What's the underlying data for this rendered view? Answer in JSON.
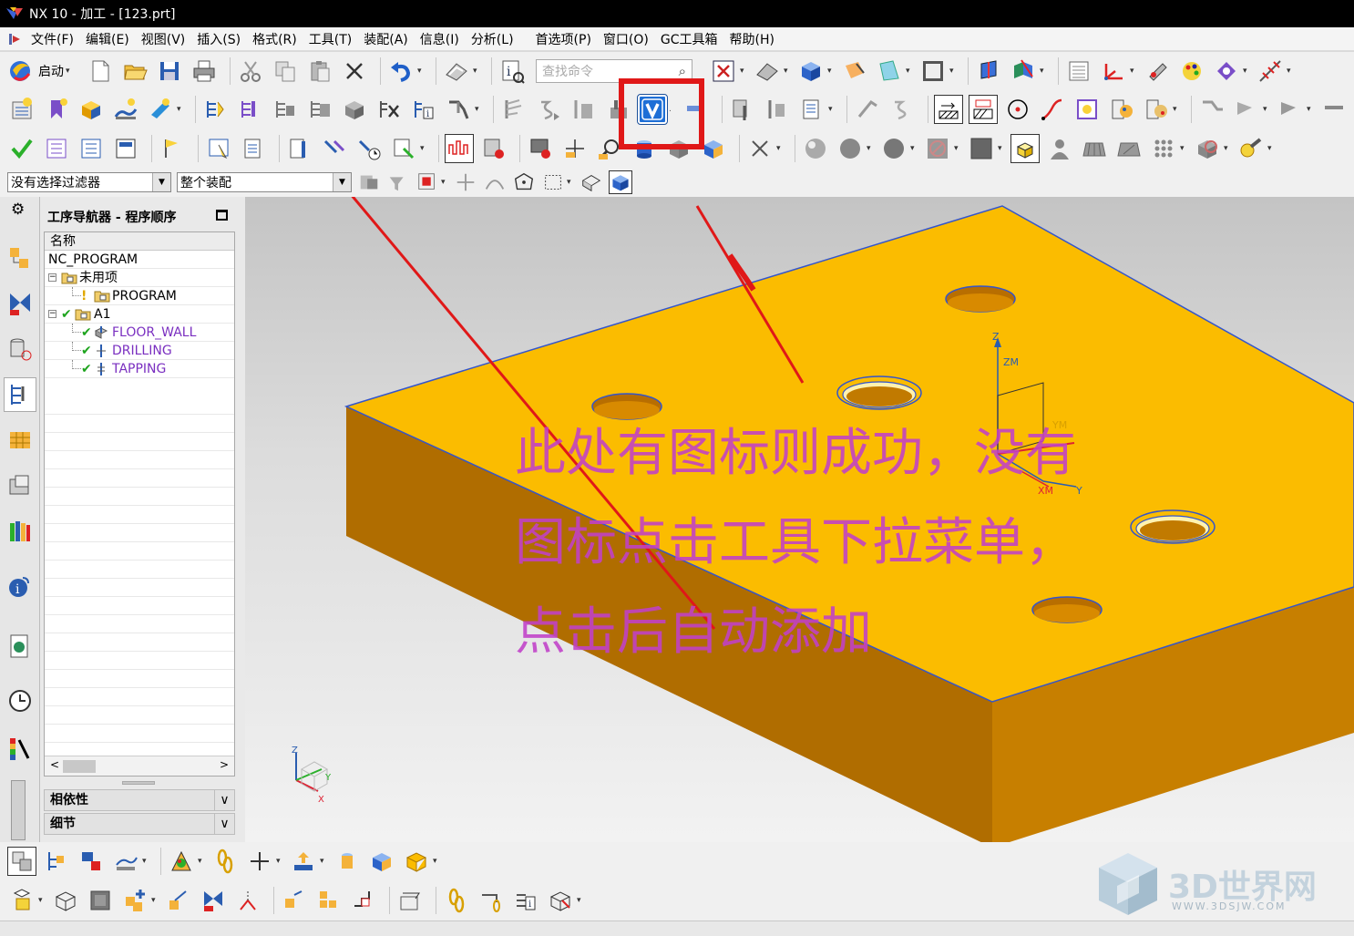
{
  "window": {
    "title": "NX 10 - 加工 - [123.prt]"
  },
  "menu": {
    "items": [
      {
        "label": "文件(F)"
      },
      {
        "label": "编辑(E)"
      },
      {
        "label": "视图(V)"
      },
      {
        "label": "插入(S)"
      },
      {
        "label": "格式(R)"
      },
      {
        "label": "工具(T)"
      },
      {
        "label": "装配(A)"
      },
      {
        "label": "信息(I)"
      },
      {
        "label": "分析(L)"
      },
      {
        "label": "首选项(P)"
      },
      {
        "label": "窗口(O)"
      },
      {
        "label": "GC工具箱"
      },
      {
        "label": "帮助(H)"
      }
    ]
  },
  "toolbar": {
    "start_label": "启动",
    "search_placeholder": "查找命令"
  },
  "selection": {
    "filter_value": "没有选择过滤器",
    "scope_value": "整个装配"
  },
  "navigator": {
    "title": "工序导航器 - 程序顺序",
    "column_name": "名称",
    "rows": [
      {
        "label": "NC_PROGRAM"
      },
      {
        "label": "未用项"
      },
      {
        "label": "PROGRAM"
      },
      {
        "label": "A1"
      },
      {
        "label": "FLOOR_WALL"
      },
      {
        "label": "DRILLING"
      },
      {
        "label": "TAPPING"
      }
    ],
    "panels": [
      {
        "label": "相依性"
      },
      {
        "label": "细节"
      }
    ]
  },
  "annotation": {
    "lines": [
      "此处有图标则成功，没有",
      "图标点击工具下拉菜单，",
      "点击后自动添加"
    ],
    "color": "#c040c8",
    "highlight_color": "#e01818"
  },
  "csys": {
    "z": "Z",
    "zm": "ZM",
    "ym": "YM",
    "xm": "XM",
    "y": "Y"
  },
  "mini_csys": {
    "z": "Z",
    "y": "Y",
    "x": "X"
  },
  "part_colors": {
    "top": "#fbbc00",
    "side_front": "#b06d00",
    "side_left": "#c77f00",
    "edge": "#3355cc"
  },
  "watermark": {
    "main": "3D世界网",
    "sub": "WWW.3DSJW.COM"
  }
}
